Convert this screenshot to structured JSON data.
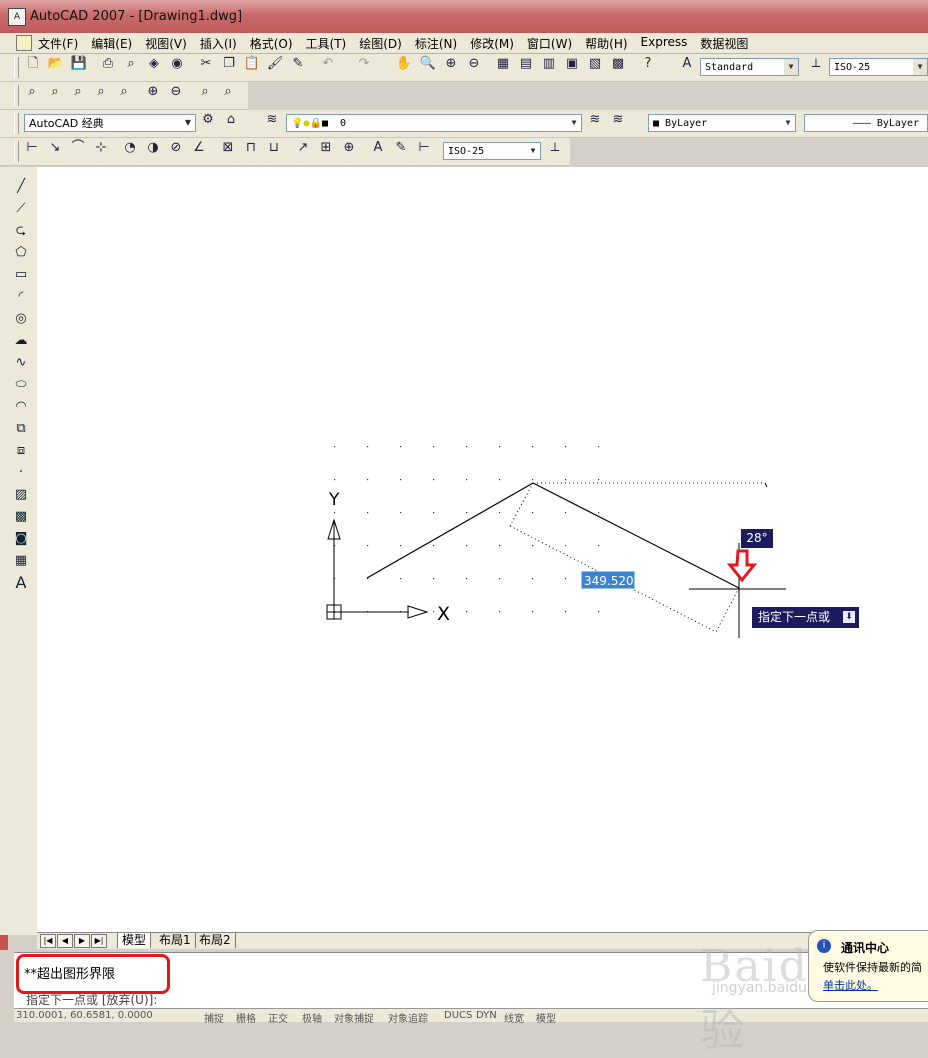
{
  "window": {
    "title": "AutoCAD 2007 - [Drawing1.dwg]",
    "app_icon": "autocad-icon"
  },
  "menu": {
    "items": [
      "文件(F)",
      "编辑(E)",
      "视图(V)",
      "插入(I)",
      "格式(O)",
      "工具(T)",
      "绘图(D)",
      "标注(N)",
      "修改(M)",
      "窗口(W)",
      "帮助(H)",
      "Express",
      "数据视图"
    ]
  },
  "toolbars": {
    "text_style": "Standard",
    "dim_style": "ISO-25",
    "workspace": "AutoCAD 经典",
    "layer": "0",
    "color": "ByLayer",
    "linetype": "ByLayer",
    "dim_style_2": "ISO-25"
  },
  "drawing": {
    "length_input": "349.5201",
    "angle_input": "28°",
    "prompt_tooltip": "指定下一点或",
    "axis_y": "Y",
    "axis_x": "X"
  },
  "layout_tabs": [
    "模型",
    "布局1",
    "布局2"
  ],
  "command": {
    "line1": "**超出图形界限",
    "line2": "指定下一点或 [放弃(U)]:"
  },
  "status_bar": {
    "coords": "310.0001, 60.6581, 0.0000",
    "buttons": [
      "捕捉",
      "栅格",
      "正交",
      "极轴",
      "对象捕捉",
      "对象追踪",
      "DUCS",
      "DYN",
      "线宽",
      "模型"
    ]
  },
  "notification": {
    "title": "通讯中心",
    "body": "使软件保持最新的简",
    "link": "单击此处。"
  },
  "watermark": {
    "text": "Baidu经验",
    "sub": "jingyan.baidu.com"
  },
  "colors": {
    "highlight_box": "#e01a1a",
    "arrow": "#e01a1a",
    "tooltip_bg": "#1b1b5e",
    "input_bg": "#3d81d4"
  }
}
